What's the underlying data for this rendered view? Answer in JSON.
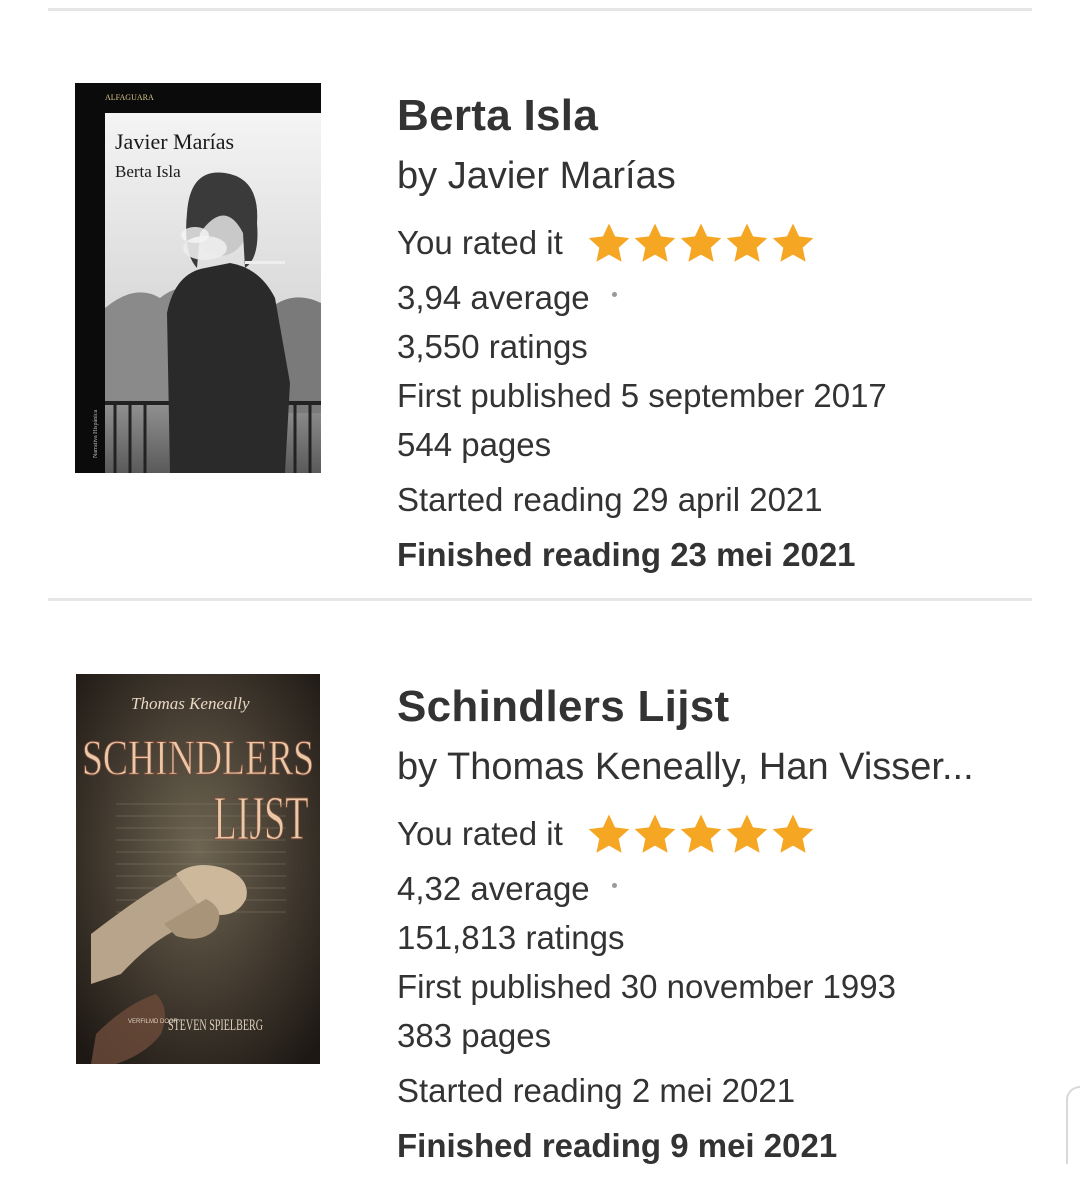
{
  "books": [
    {
      "title": "Berta Isla",
      "author": "by Javier Marías",
      "rated_label": "You rated it",
      "rating": 5,
      "average": "3,94 average",
      "ratings": "3,550 ratings",
      "published": "First published 5 september 2017",
      "pages": "544 pages",
      "started": "Started reading 29 april 2021",
      "finished": "Finished reading 23 mei 2021",
      "cover": {
        "publisher": "ALFAGUARA",
        "author": "Javier Marías",
        "title": "Berta Isla",
        "series": "Narrativa Hispánica"
      }
    },
    {
      "title": "Schindlers Lijst",
      "author": "by Thomas Keneally, Han Visser...",
      "rated_label": "You rated it",
      "rating": 5,
      "average": "4,32 average",
      "ratings": "151,813 ratings",
      "published": "First published 30 november 1993",
      "pages": "383 pages",
      "started": "Started reading 2 mei 2021",
      "finished": "Finished reading 9 mei 2021",
      "cover": {
        "author": "Thomas Keneally",
        "title_line1": "SCHINDLERS",
        "title_line2": "LIJST",
        "credit_small": "VERFILMD DOOR",
        "credit": "STEVEN SPIELBERG"
      }
    }
  ],
  "colors": {
    "star": "#f5a623",
    "text": "#333333",
    "divider": "#e6e6e6"
  },
  "icons": {
    "star": "star-icon",
    "separator": "dot-separator"
  }
}
